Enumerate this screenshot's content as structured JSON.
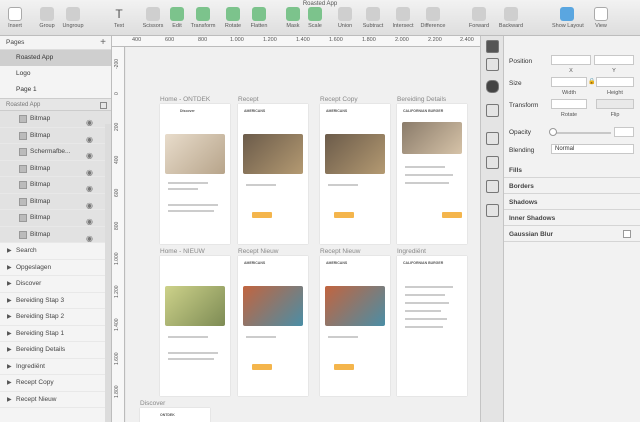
{
  "window": {
    "title": "Roasted App"
  },
  "toolbar": {
    "items": [
      "Insert",
      "Group",
      "Ungroup",
      "Text",
      "Scissors",
      "Edit",
      "Transform",
      "Rotate",
      "Flatten",
      "Mask",
      "Scale",
      "Union",
      "Subtract",
      "Intersect",
      "Difference",
      "Forward",
      "Backward",
      "Show Layout",
      "View"
    ]
  },
  "pages": {
    "header": "Pages",
    "items": [
      "Roasted App",
      "Logo",
      "Page 1"
    ]
  },
  "layers": {
    "header": "Roasted App",
    "children": [
      "Bitmap",
      "Bitmap",
      "Schermafbe...",
      "Bitmap",
      "Bitmap",
      "Bitmap",
      "Bitmap",
      "Bitmap"
    ],
    "groups": [
      "Search",
      "Opgeslagen",
      "Discover",
      "Bereiding Stap 3",
      "Bereiding Stap 2",
      "Bereiding Stap 1",
      "Bereiding Details",
      "Ingrediënt",
      "Recept Copy",
      "Recept Nieuw"
    ]
  },
  "ruler": {
    "top": [
      "400",
      "600",
      "800",
      "1.000",
      "1.200",
      "1.400",
      "1.600",
      "1.800",
      "2.000",
      "2.200",
      "2.400"
    ],
    "left": [
      "-200",
      "0",
      "200",
      "400",
      "600",
      "800",
      "1.000",
      "1.200",
      "1.400",
      "1.600",
      "1.800"
    ]
  },
  "artboards": {
    "row1": [
      "Home - ONTDEK",
      "Recept",
      "Recept Copy",
      "Bereiding Details"
    ],
    "row2": [
      "Home - NIEUW",
      "Recept Nieuw",
      "Recept Nieuw",
      "Ingrediënt"
    ],
    "row3": [
      "Discover"
    ],
    "headers": [
      "AMERICANS",
      "AMERICANS",
      "CALIFORNIAN BURGER",
      "AMERICANS",
      "AMERICANS",
      "CALIFORNIAN BURGER",
      "ONTDEK"
    ]
  },
  "inspector": {
    "position": "Position",
    "x": "X",
    "y": "Y",
    "size": "Size",
    "width": "Width",
    "height": "Height",
    "transform": "Transform",
    "rotate": "Rotate",
    "flip": "Flip",
    "opacity": "Opacity",
    "blending": "Blending",
    "blend_mode": "Normal",
    "sections": [
      "Fills",
      "Borders",
      "Shadows",
      "Inner Shadows",
      "Gaussian Blur"
    ]
  }
}
